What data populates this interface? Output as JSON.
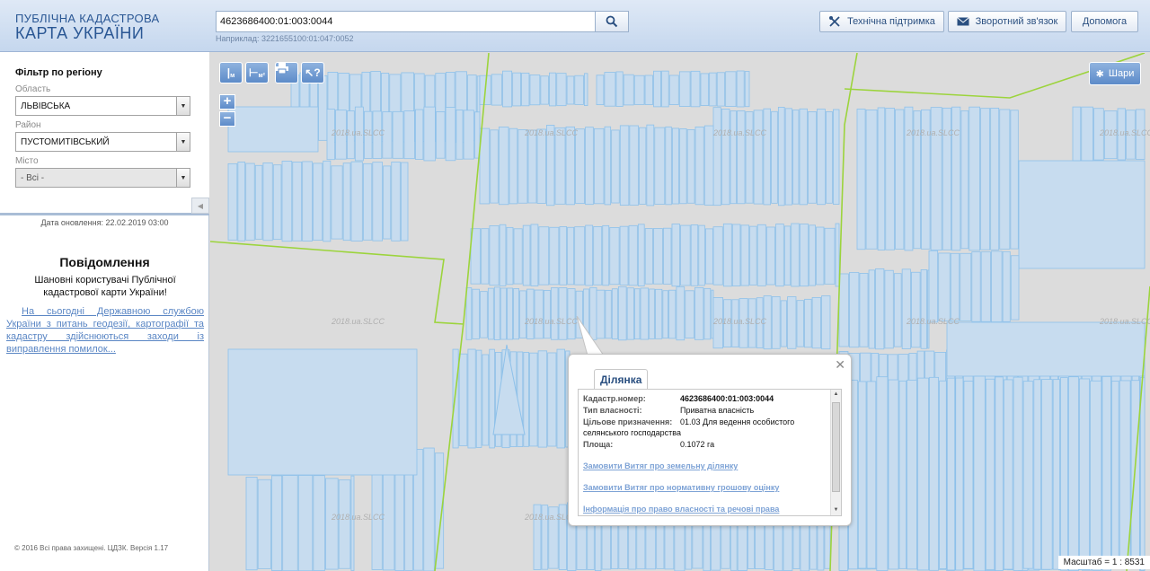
{
  "header": {
    "logo_line1": "ПУБЛІЧНА КАДАСТРОВА",
    "logo_line2": "КАРТА УКРАЇНИ",
    "search_value": "4623686400:01:003:0044",
    "search_hint": "Наприклад: 3221655100:01:047:0052",
    "support_label": "Технічна підтримка",
    "feedback_label": "Зворотний зв'язок",
    "help_label": "Допомога"
  },
  "sidebar": {
    "filter_title": "Фільтр по регіону",
    "oblast_label": "Область",
    "oblast_value": "ЛЬВІВСЬКА",
    "raion_label": "Район",
    "raion_value": "ПУСТОМИТІВСЬКИЙ",
    "city_label": "Місто",
    "city_value": "- Всі -",
    "update_date": "Дата оновлення: 22.02.2019 03:00",
    "message_title": "Повідомлення",
    "message_text": "Шановні користувачі Публічної кадастрової карти України!",
    "message_link": "На сьогодні Державною службою України з питань геодезії, картографії та кадастру здійснюються заходи із виправлення помилок...",
    "copyright": "© 2016 Всі права захищені. ЦДЗК. Версія 1.17"
  },
  "map": {
    "layers_label": "Шари",
    "scale": "Масштаб = 1 : 8531",
    "watermark": "2018.ua.SLCC",
    "tool_ruler_label": "м",
    "tool_area_label": "м²"
  },
  "popup": {
    "tab": "Ділянка",
    "cadnum_label": "Кадастр.номер:",
    "cadnum_value": "4623686400:01:003:0044",
    "ownership_label": "Тип власності:",
    "ownership_value": "Приватна власність",
    "purpose_label": "Цільове призначення:",
    "purpose_value": "01.03 Для ведення особистого селянського господарства",
    "area_label": "Площа:",
    "area_value": "0.1072 га",
    "link1": "Замовити Витяг про земельну ділянку",
    "link2": "Замовити Витяг про нормативну грошову оцінку",
    "link3": "Інформація про право власності та речові права"
  },
  "colors": {
    "parcel_fill": "#c7dcef",
    "parcel_stroke": "#8ec1ea",
    "boundary": "#9cd43c",
    "accent": "#5d8bc9"
  }
}
